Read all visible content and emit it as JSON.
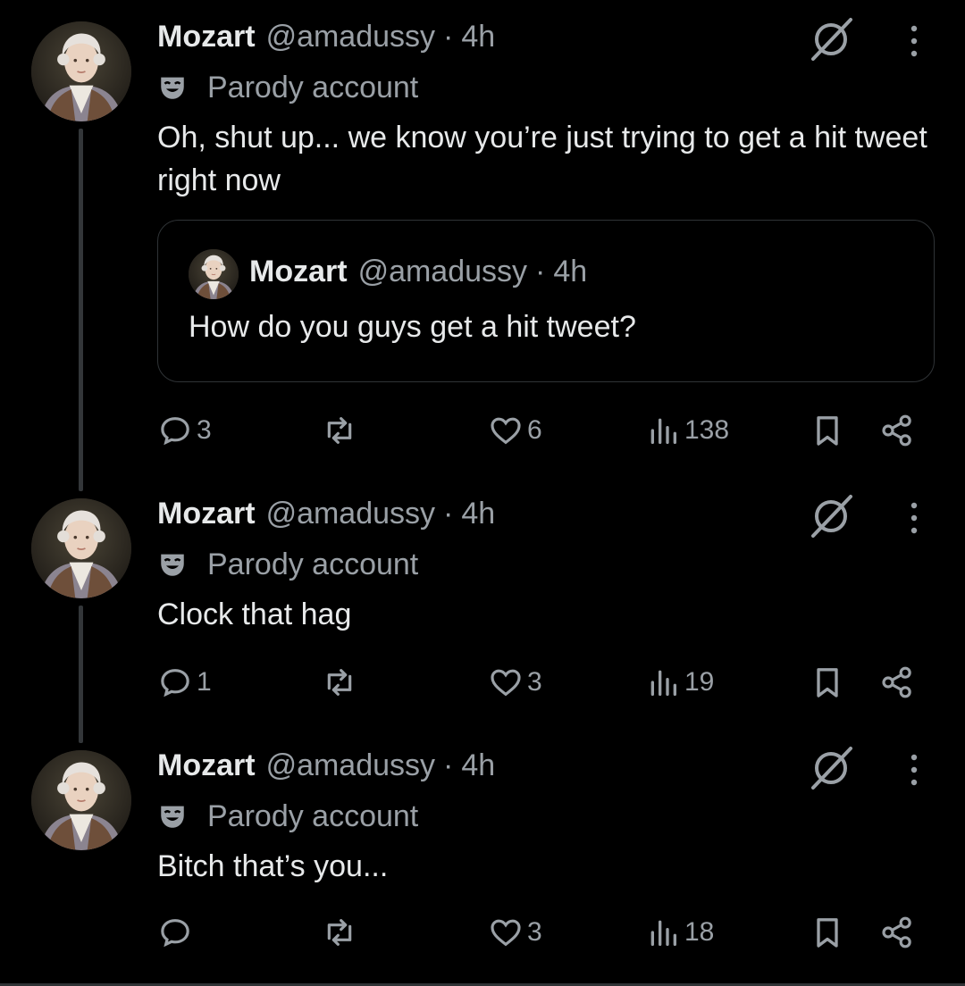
{
  "tweets": [
    {
      "name": "Mozart",
      "handle": "@amadussy",
      "dot": "·",
      "time": "4h",
      "parody": "Parody account",
      "text": "Oh, shut up... we know you’re just trying to get a hit tweet right now",
      "quote": {
        "name": "Mozart",
        "handle": "@amadussy",
        "dot": "·",
        "time": "4h",
        "text": "How do you guys get a hit tweet?"
      },
      "replies": "3",
      "reposts": "",
      "likes": "6",
      "views": "138"
    },
    {
      "name": "Mozart",
      "handle": "@amadussy",
      "dot": "·",
      "time": "4h",
      "parody": "Parody account",
      "text": "Clock that hag",
      "replies": "1",
      "reposts": "",
      "likes": "3",
      "views": "19"
    },
    {
      "name": "Mozart",
      "handle": "@amadussy",
      "dot": "·",
      "time": "4h",
      "parody": "Parody account",
      "text": "Bitch that’s you...",
      "replies": "",
      "reposts": "",
      "likes": "3",
      "views": "18"
    }
  ],
  "icons": {
    "grok": "grok-icon",
    "more": "more-vertical-icon",
    "parody": "parody-mask-icon",
    "reply": "reply-icon",
    "repost": "repost-icon",
    "like": "heart-icon",
    "views": "views-chart-icon",
    "bookmark": "bookmark-icon",
    "share": "share-icon"
  },
  "colors": {
    "background": "#000000",
    "text": "#e7e9ea",
    "secondary": "#9aa0a6",
    "border": "#2f3336"
  }
}
